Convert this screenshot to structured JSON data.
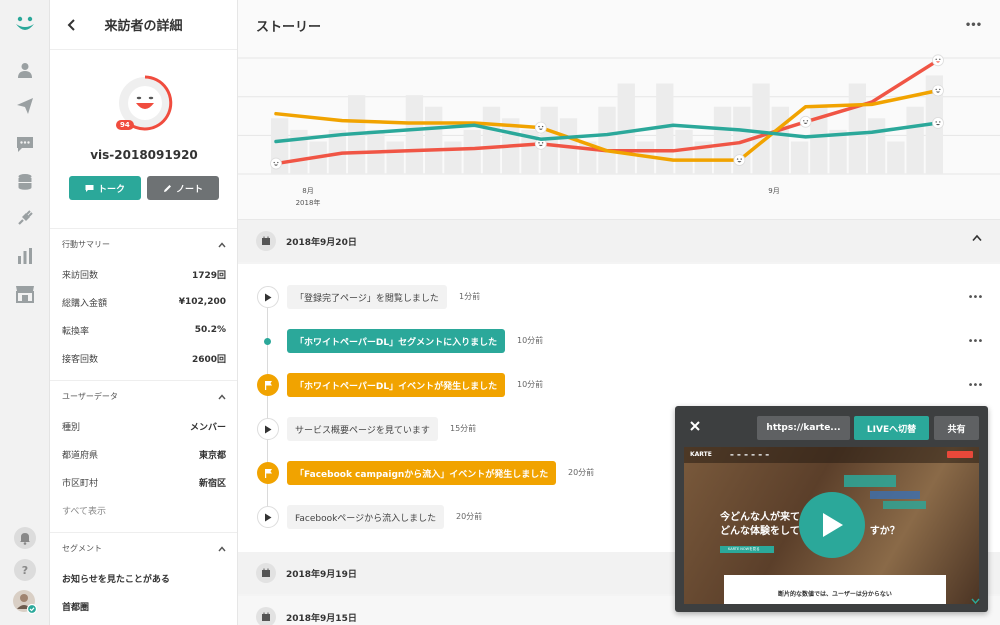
{
  "panel": {
    "title": "来訪者の詳細",
    "score": "94",
    "visitor_id": "vis-2018091920",
    "talk_label": "トーク",
    "note_label": "ノート"
  },
  "summary": {
    "title": "行動サマリー",
    "rows": [
      {
        "label": "来訪回数",
        "value": "1729回"
      },
      {
        "label": "総購入金額",
        "value": "¥102,200"
      },
      {
        "label": "転換率",
        "value": "50.2%"
      },
      {
        "label": "接客回数",
        "value": "2600回"
      }
    ]
  },
  "userdata": {
    "title": "ユーザーデータ",
    "rows": [
      {
        "label": "種別",
        "value": "メンバー"
      },
      {
        "label": "都道府県",
        "value": "東京都"
      },
      {
        "label": "市区町村",
        "value": "新宿区"
      }
    ],
    "show_all": "すべて表示"
  },
  "segment": {
    "title": "セグメント",
    "items": [
      "お知らせを見たことがある",
      "首都圏"
    ]
  },
  "main": {
    "title": "ストーリー"
  },
  "chart_data": {
    "type": "line",
    "x_ticks": [
      {
        "label": "8月",
        "sub": "2018年"
      },
      {
        "label": "9月",
        "sub": ""
      }
    ],
    "bars": [
      0.48,
      0.38,
      0.28,
      0.38,
      0.68,
      0.38,
      0.28,
      0.68,
      0.58,
      0.28,
      0.38,
      0.58,
      0.48,
      0.38,
      0.58,
      0.48,
      0.28,
      0.58,
      0.78,
      0.28,
      0.78,
      0.38,
      0.28,
      0.58,
      0.58,
      0.78,
      0.58,
      0.28,
      0.58,
      0.38,
      0.78,
      0.48,
      0.28,
      0.58,
      0.85
    ],
    "series": [
      {
        "color": "#f05545",
        "values": [
          0.09,
          0.18,
          0.2,
          0.22,
          0.26,
          0.2,
          0.2,
          0.27,
          0.45,
          0.62,
          0.98
        ],
        "face_points": [
          0,
          4,
          8,
          10
        ]
      },
      {
        "color": "#f1a300",
        "values": [
          0.52,
          0.46,
          0.44,
          0.44,
          0.4,
          0.2,
          0.12,
          0.12,
          0.58,
          0.6,
          0.72
        ],
        "face_points": [
          4,
          7,
          10
        ]
      },
      {
        "color": "#2ba89a",
        "values": [
          0.28,
          0.34,
          0.38,
          0.42,
          0.3,
          0.34,
          0.42,
          0.38,
          0.32,
          0.36,
          0.44
        ],
        "face_points": [
          10
        ]
      }
    ]
  },
  "dates": [
    "2018年9月20日",
    "2018年9月19日",
    "2018年9月15日"
  ],
  "events": [
    {
      "kind": "play",
      "style": "gray",
      "text": "「登録完了ページ」を閲覧しました",
      "time": "1分前"
    },
    {
      "kind": "mini",
      "style": "teal",
      "text": "「ホワイトペーパーDL」セグメントに入りました",
      "time": "10分前"
    },
    {
      "kind": "flag",
      "style": "orange",
      "text": "「ホワイトペーパーDL」イベントが発生しました",
      "time": "10分前"
    },
    {
      "kind": "play",
      "style": "gray",
      "text": "サービス概要ページを見ています",
      "time": "15分前"
    },
    {
      "kind": "flag",
      "style": "orange",
      "text": "「Facebook campaignから流入」イベントが発生しました",
      "time": "20分前"
    },
    {
      "kind": "play",
      "style": "gray",
      "text": "Facebookページから流入しました",
      "time": "20分前"
    }
  ],
  "live": {
    "url": "https://karte...",
    "golive": "LIVEへ切替",
    "share": "共有",
    "screen": {
      "logo": "KARTE",
      "headline_1": "今どんな人が来て、",
      "headline_2": "どんな体験をしてい",
      "headline_tail": "すか？",
      "card_text": "断片的な数値では、ユーザーは分からない",
      "cta": "KARTE NOWを見る"
    }
  },
  "colors": {
    "teal": "#2ba89a",
    "orange": "#f1a300",
    "red": "#f05545"
  }
}
